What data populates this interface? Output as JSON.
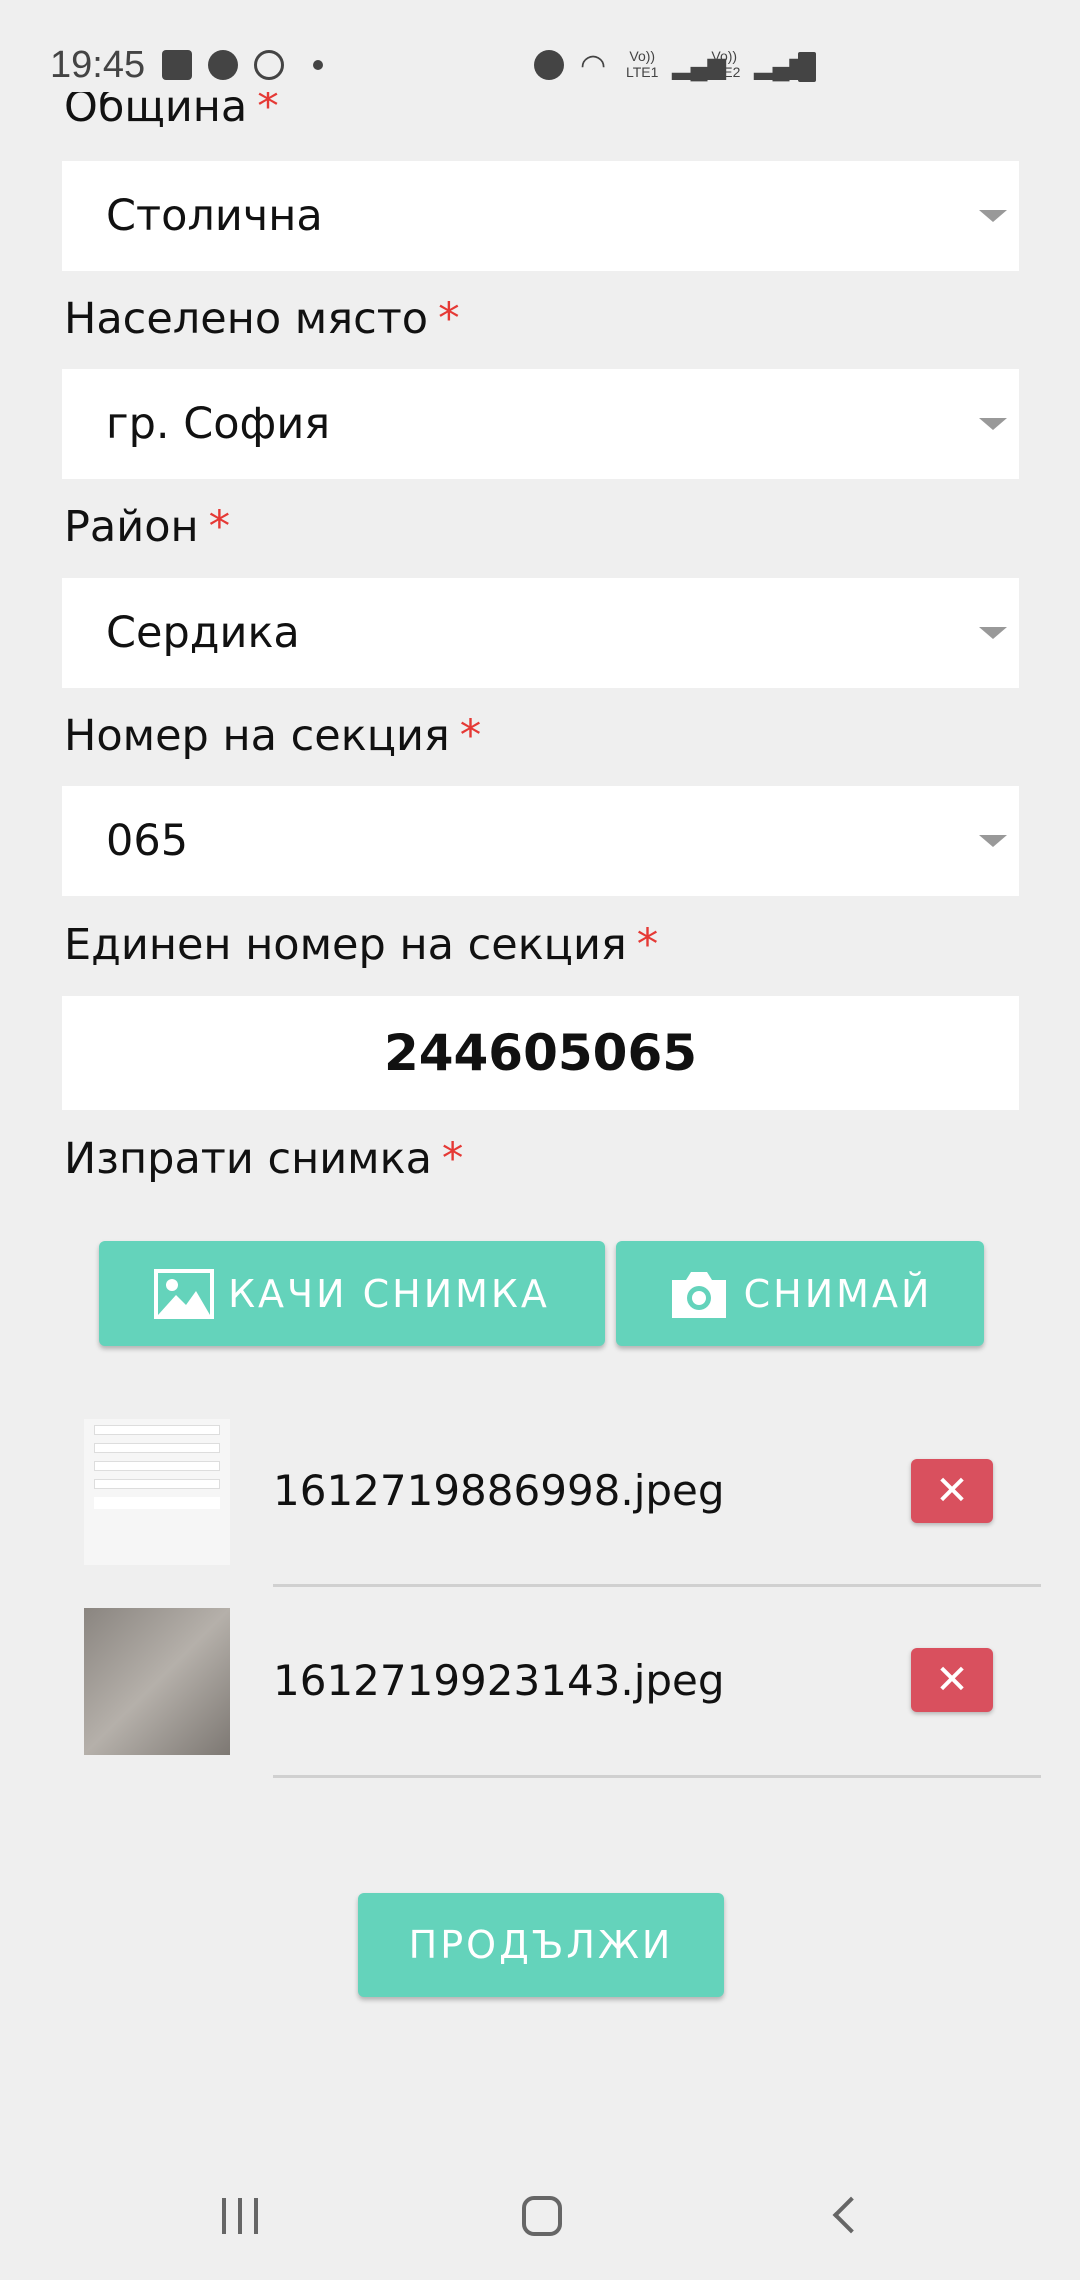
{
  "status_bar": {
    "time": "19:45",
    "lte1": "LTE1",
    "lte2": "LTE2",
    "volte": "Vo))"
  },
  "form": {
    "municipality": {
      "label": "Община",
      "required": "*",
      "value": "Столична"
    },
    "settlement": {
      "label": "Населено място",
      "required": "*",
      "value": "гр. София"
    },
    "district": {
      "label": "Район",
      "required": "*",
      "value": "Сердика"
    },
    "section": {
      "label": "Номер на секция",
      "required": "*",
      "value": "065"
    },
    "unique_section": {
      "label": "Единен номер на секция",
      "required": "*",
      "value": "244605065"
    },
    "photo": {
      "label": "Изпрати снимка",
      "required": "*"
    }
  },
  "buttons": {
    "upload": "КАЧИ СНИМКА",
    "capture": "СНИМАЙ",
    "continue": "ПРОДЪЛЖИ",
    "delete": "✕"
  },
  "files": [
    {
      "name": "1612719886998.jpeg"
    },
    {
      "name": "1612719923143.jpeg"
    }
  ],
  "colors": {
    "accent": "#64d3bb",
    "danger": "#d9505e",
    "required": "#e53935"
  }
}
